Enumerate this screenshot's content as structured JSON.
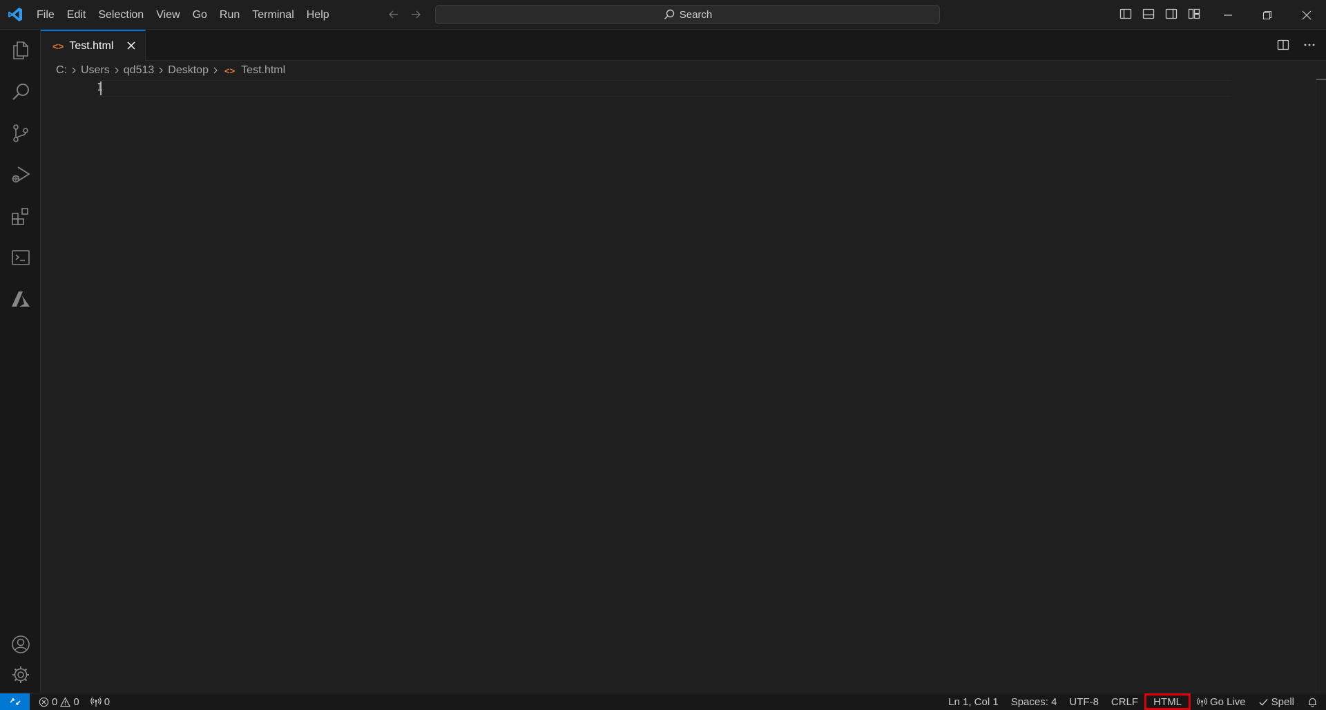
{
  "menu": [
    "File",
    "Edit",
    "Selection",
    "View",
    "Go",
    "Run",
    "Terminal",
    "Help"
  ],
  "search": {
    "label": "Search"
  },
  "tab": {
    "label": "Test.html",
    "icon": "html-file-icon"
  },
  "breadcrumb": [
    "C:",
    "Users",
    "qd513",
    "Desktop",
    "Test.html"
  ],
  "editor": {
    "line_numbers": [
      "1"
    ]
  },
  "status": {
    "errors": "0",
    "warnings": "0",
    "ports": "0",
    "position": "Ln 1, Col 1",
    "spaces": "Spaces: 4",
    "encoding": "UTF-8",
    "eol": "CRLF",
    "language": "HTML",
    "go_live": "Go Live",
    "spell": "Spell"
  },
  "colors": {
    "accent": "#0078d4",
    "html_icon": "#e37933",
    "highlight_box": "#e0000a"
  }
}
